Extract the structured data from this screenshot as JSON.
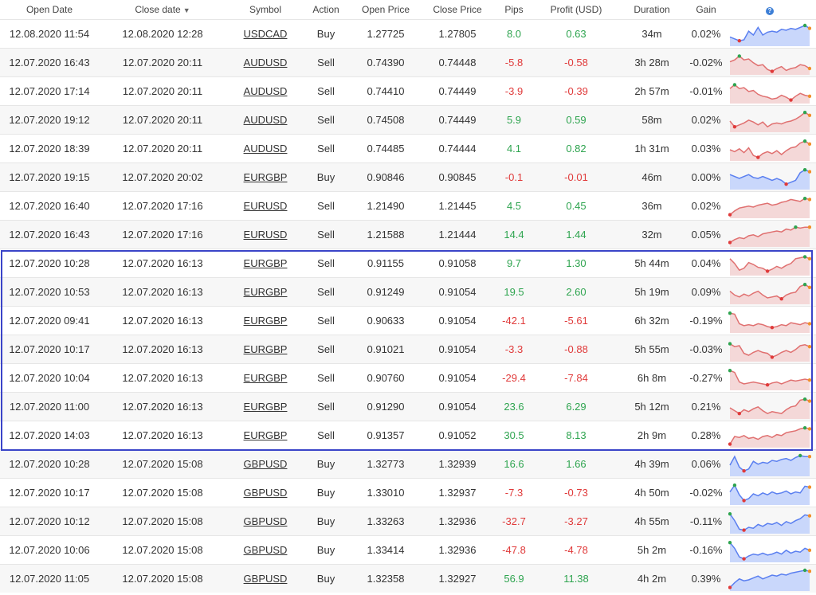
{
  "headers": {
    "open_date": "Open Date",
    "close_date": "Close date",
    "symbol": "Symbol",
    "action": "Action",
    "open_price": "Open Price",
    "close_price": "Close Price",
    "pips": "Pips",
    "profit": "Profit (USD)",
    "duration": "Duration",
    "gain": "Gain",
    "sort_icon": "triangle-down-icon",
    "help_icon": "question-circle-icon"
  },
  "colors": {
    "positive": "#2ea44f",
    "negative": "#e03a3a",
    "buy_fill": "#c9d7fb",
    "buy_line": "#5a7ff0",
    "sell_fill": "#f4d8d8",
    "sell_line": "#e07070",
    "highlight": "#3a44c8"
  },
  "rows": [
    {
      "open": "12.08.2020 11:54",
      "close": "12.08.2020 12:28",
      "symbol": "USDCAD",
      "action": "Buy",
      "open_price": "1.27725",
      "close_price": "1.27805",
      "pips": "8.0",
      "profit": "0.63",
      "duration": "34m",
      "gain": "0.02%",
      "spark": [
        0.4,
        0.3,
        0.2,
        0.25,
        0.7,
        0.5,
        0.9,
        0.5,
        0.65,
        0.7,
        0.65,
        0.8,
        0.75,
        0.85,
        0.8,
        0.9,
        1.0,
        0.85
      ]
    },
    {
      "open": "12.07.2020 16:43",
      "close": "12.07.2020 20:11",
      "symbol": "AUDUSD",
      "action": "Sell",
      "open_price": "0.74390",
      "close_price": "0.74448",
      "pips": "-5.8",
      "profit": "-0.58",
      "duration": "3h 28m",
      "gain": "-0.02%",
      "spark": [
        0.6,
        0.7,
        0.9,
        0.7,
        0.75,
        0.55,
        0.4,
        0.45,
        0.2,
        0.1,
        0.25,
        0.35,
        0.15,
        0.25,
        0.3,
        0.45,
        0.4,
        0.25
      ]
    },
    {
      "open": "12.07.2020 17:14",
      "close": "12.07.2020 20:11",
      "symbol": "AUDUSD",
      "action": "Sell",
      "open_price": "0.74410",
      "close_price": "0.74449",
      "pips": "-3.9",
      "profit": "-0.39",
      "duration": "2h 57m",
      "gain": "-0.01%",
      "spark": [
        0.7,
        0.9,
        0.7,
        0.75,
        0.55,
        0.6,
        0.4,
        0.3,
        0.25,
        0.15,
        0.2,
        0.35,
        0.25,
        0.1,
        0.3,
        0.45,
        0.35,
        0.3
      ]
    },
    {
      "open": "12.07.2020 19:12",
      "close": "12.07.2020 20:11",
      "symbol": "AUDUSD",
      "action": "Sell",
      "open_price": "0.74508",
      "close_price": "0.74449",
      "pips": "5.9",
      "profit": "0.59",
      "duration": "58m",
      "gain": "0.02%",
      "spark": [
        0.5,
        0.2,
        0.3,
        0.4,
        0.55,
        0.45,
        0.3,
        0.45,
        0.2,
        0.35,
        0.4,
        0.35,
        0.45,
        0.5,
        0.6,
        0.75,
        0.95,
        0.8
      ]
    },
    {
      "open": "12.07.2020 18:39",
      "close": "12.07.2020 20:11",
      "symbol": "AUDUSD",
      "action": "Sell",
      "open_price": "0.74485",
      "close_price": "0.74444",
      "pips": "4.1",
      "profit": "0.82",
      "duration": "1h 31m",
      "gain": "0.03%",
      "spark": [
        0.5,
        0.4,
        0.55,
        0.35,
        0.6,
        0.2,
        0.1,
        0.3,
        0.4,
        0.3,
        0.45,
        0.25,
        0.45,
        0.6,
        0.65,
        0.85,
        0.95,
        0.8
      ]
    },
    {
      "open": "12.07.2020 19:15",
      "close": "12.07.2020 20:02",
      "symbol": "EURGBP",
      "action": "Buy",
      "open_price": "0.90846",
      "close_price": "0.90845",
      "pips": "-0.1",
      "profit": "-0.01",
      "duration": "46m",
      "gain": "0.00%",
      "spark": [
        0.7,
        0.6,
        0.5,
        0.6,
        0.7,
        0.55,
        0.5,
        0.6,
        0.5,
        0.4,
        0.5,
        0.4,
        0.2,
        0.3,
        0.4,
        0.8,
        0.95,
        0.85
      ]
    },
    {
      "open": "12.07.2020 16:40",
      "close": "12.07.2020 17:16",
      "symbol": "EURUSD",
      "action": "Sell",
      "open_price": "1.21490",
      "close_price": "1.21445",
      "pips": "4.5",
      "profit": "0.45",
      "duration": "36m",
      "gain": "0.02%",
      "spark": [
        0.1,
        0.3,
        0.45,
        0.5,
        0.55,
        0.5,
        0.6,
        0.65,
        0.7,
        0.6,
        0.65,
        0.75,
        0.8,
        0.9,
        0.85,
        0.8,
        0.95,
        0.9
      ]
    },
    {
      "open": "12.07.2020 16:43",
      "close": "12.07.2020 17:16",
      "symbol": "EURUSD",
      "action": "Sell",
      "open_price": "1.21588",
      "close_price": "1.21444",
      "pips": "14.4",
      "profit": "1.44",
      "duration": "32m",
      "gain": "0.05%",
      "spark": [
        0.15,
        0.3,
        0.4,
        0.35,
        0.5,
        0.55,
        0.45,
        0.6,
        0.65,
        0.7,
        0.75,
        0.7,
        0.85,
        0.8,
        0.95,
        0.9,
        0.95,
        0.95
      ]
    },
    {
      "open": "12.07.2020 10:28",
      "close": "12.07.2020 16:13",
      "symbol": "EURGBP",
      "action": "Sell",
      "open_price": "0.91155",
      "close_price": "0.91058",
      "pips": "9.7",
      "profit": "1.30",
      "duration": "5h 44m",
      "gain": "0.04%",
      "spark": [
        0.8,
        0.55,
        0.2,
        0.3,
        0.6,
        0.5,
        0.35,
        0.3,
        0.15,
        0.25,
        0.4,
        0.3,
        0.45,
        0.55,
        0.8,
        0.85,
        0.9,
        0.8
      ]
    },
    {
      "open": "12.07.2020 10:53",
      "close": "12.07.2020 16:13",
      "symbol": "EURGBP",
      "action": "Sell",
      "open_price": "0.91249",
      "close_price": "0.91054",
      "pips": "19.5",
      "profit": "2.60",
      "duration": "5h 19m",
      "gain": "0.09%",
      "spark": [
        0.6,
        0.4,
        0.3,
        0.45,
        0.35,
        0.5,
        0.6,
        0.4,
        0.25,
        0.3,
        0.35,
        0.2,
        0.4,
        0.5,
        0.55,
        0.85,
        0.95,
        0.8
      ]
    },
    {
      "open": "12.07.2020 09:41",
      "close": "12.07.2020 16:13",
      "symbol": "EURGBP",
      "action": "Sell",
      "open_price": "0.90633",
      "close_price": "0.91054",
      "pips": "-42.1",
      "profit": "-5.61",
      "duration": "6h 32m",
      "gain": "-0.19%",
      "spark": [
        0.95,
        0.9,
        0.4,
        0.3,
        0.35,
        0.3,
        0.4,
        0.35,
        0.25,
        0.2,
        0.25,
        0.35,
        0.3,
        0.45,
        0.4,
        0.35,
        0.45,
        0.4
      ]
    },
    {
      "open": "12.07.2020 10:17",
      "close": "12.07.2020 16:13",
      "symbol": "EURGBP",
      "action": "Sell",
      "open_price": "0.91021",
      "close_price": "0.91054",
      "pips": "-3.3",
      "profit": "-0.88",
      "duration": "5h 55m",
      "gain": "-0.03%",
      "spark": [
        0.85,
        0.7,
        0.75,
        0.35,
        0.25,
        0.4,
        0.5,
        0.4,
        0.35,
        0.15,
        0.25,
        0.4,
        0.5,
        0.4,
        0.55,
        0.75,
        0.8,
        0.7
      ]
    },
    {
      "open": "12.07.2020 10:04",
      "close": "12.07.2020 16:13",
      "symbol": "EURGBP",
      "action": "Sell",
      "open_price": "0.90760",
      "close_price": "0.91054",
      "pips": "-29.4",
      "profit": "-7.84",
      "duration": "6h 8m",
      "gain": "-0.27%",
      "spark": [
        0.95,
        0.85,
        0.35,
        0.25,
        0.3,
        0.35,
        0.3,
        0.25,
        0.2,
        0.3,
        0.35,
        0.25,
        0.35,
        0.45,
        0.4,
        0.45,
        0.5,
        0.45
      ]
    },
    {
      "open": "12.07.2020 11:00",
      "close": "12.07.2020 16:13",
      "symbol": "EURGBP",
      "action": "Sell",
      "open_price": "0.91290",
      "close_price": "0.91054",
      "pips": "23.6",
      "profit": "6.29",
      "duration": "5h 12m",
      "gain": "0.21%",
      "spark": [
        0.5,
        0.35,
        0.2,
        0.4,
        0.3,
        0.45,
        0.55,
        0.35,
        0.2,
        0.3,
        0.25,
        0.2,
        0.4,
        0.55,
        0.6,
        0.9,
        0.95,
        0.85
      ]
    },
    {
      "open": "12.07.2020 14:03",
      "close": "12.07.2020 16:13",
      "symbol": "EURGBP",
      "action": "Sell",
      "open_price": "0.91357",
      "close_price": "0.91052",
      "pips": "30.5",
      "profit": "8.13",
      "duration": "2h 9m",
      "gain": "0.28%",
      "spark": [
        0.1,
        0.5,
        0.45,
        0.55,
        0.4,
        0.45,
        0.35,
        0.5,
        0.55,
        0.45,
        0.6,
        0.55,
        0.7,
        0.75,
        0.8,
        0.9,
        0.95,
        0.9
      ]
    },
    {
      "open": "12.07.2020 10:28",
      "close": "12.07.2020 15:08",
      "symbol": "GBPUSD",
      "action": "Buy",
      "open_price": "1.32773",
      "close_price": "1.32939",
      "pips": "16.6",
      "profit": "1.66",
      "duration": "4h 39m",
      "gain": "0.06%",
      "spark": [
        0.5,
        0.95,
        0.4,
        0.2,
        0.3,
        0.7,
        0.55,
        0.65,
        0.6,
        0.75,
        0.7,
        0.8,
        0.85,
        0.75,
        0.9,
        1.0,
        0.95,
        0.95
      ]
    },
    {
      "open": "12.07.2020 10:17",
      "close": "12.07.2020 15:08",
      "symbol": "GBPUSD",
      "action": "Buy",
      "open_price": "1.33010",
      "close_price": "1.32937",
      "pips": "-7.3",
      "profit": "-0.73",
      "duration": "4h 50m",
      "gain": "-0.02%",
      "spark": [
        0.6,
        0.95,
        0.45,
        0.15,
        0.25,
        0.5,
        0.4,
        0.55,
        0.45,
        0.6,
        0.5,
        0.55,
        0.65,
        0.5,
        0.6,
        0.55,
        0.9,
        0.85
      ]
    },
    {
      "open": "12.07.2020 10:12",
      "close": "12.07.2020 15:08",
      "symbol": "GBPUSD",
      "action": "Buy",
      "open_price": "1.33263",
      "close_price": "1.32936",
      "pips": "-32.7",
      "profit": "-3.27",
      "duration": "4h 55m",
      "gain": "-0.11%",
      "spark": [
        0.95,
        0.6,
        0.15,
        0.1,
        0.25,
        0.2,
        0.4,
        0.3,
        0.45,
        0.4,
        0.5,
        0.35,
        0.55,
        0.45,
        0.6,
        0.7,
        0.9,
        0.85
      ]
    },
    {
      "open": "12.07.2020 10:06",
      "close": "12.07.2020 15:08",
      "symbol": "GBPUSD",
      "action": "Buy",
      "open_price": "1.33414",
      "close_price": "1.32936",
      "pips": "-47.8",
      "profit": "-4.78",
      "duration": "5h 2m",
      "gain": "-0.16%",
      "spark": [
        0.95,
        0.65,
        0.2,
        0.1,
        0.25,
        0.35,
        0.3,
        0.4,
        0.3,
        0.35,
        0.45,
        0.35,
        0.55,
        0.4,
        0.5,
        0.45,
        0.65,
        0.55
      ]
    },
    {
      "open": "12.07.2020 11:05",
      "close": "12.07.2020 15:08",
      "symbol": "GBPUSD",
      "action": "Buy",
      "open_price": "1.32358",
      "close_price": "1.32927",
      "pips": "56.9",
      "profit": "11.38",
      "duration": "4h 2m",
      "gain": "0.39%",
      "spark": [
        0.1,
        0.35,
        0.55,
        0.45,
        0.5,
        0.6,
        0.7,
        0.55,
        0.65,
        0.75,
        0.7,
        0.8,
        0.75,
        0.85,
        0.9,
        0.95,
        1.0,
        0.95
      ]
    }
  ]
}
